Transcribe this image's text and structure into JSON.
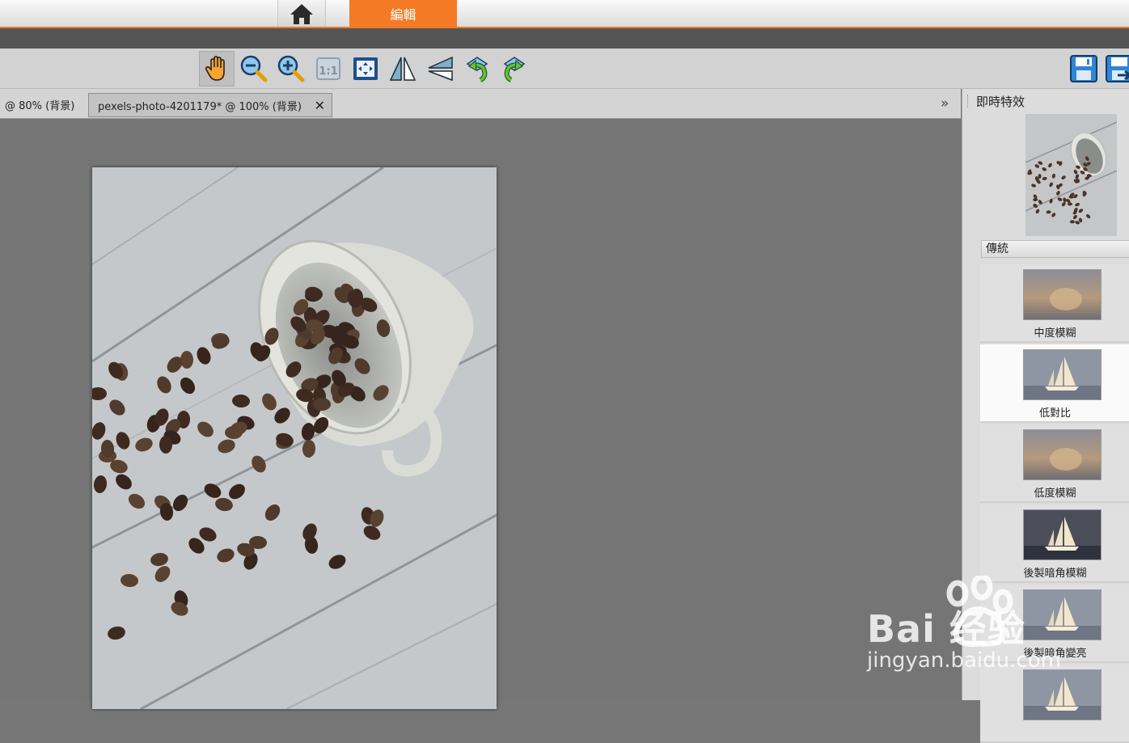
{
  "menu": {
    "edit_tab_label": "編輯"
  },
  "toolbar": {
    "tools": [
      "hand-tool",
      "zoom-out",
      "zoom-in",
      "actual-size",
      "fit-to-window",
      "flip-horizontal",
      "flip-vertical",
      "rotate-left",
      "rotate-right",
      "save",
      "save-as"
    ]
  },
  "tabs": [
    {
      "label": "@  80% (背景)"
    },
    {
      "label": "pexels-photo-4201179* @ 100% (背景)",
      "close": "✕"
    }
  ],
  "tabs_chevron": "»",
  "panel": {
    "title": "即時特效",
    "category": "傳統",
    "effects": [
      {
        "label": "中度模糊",
        "selected": false
      },
      {
        "label": "低對比",
        "selected": true
      },
      {
        "label": "低度模糊",
        "selected": false
      },
      {
        "label": "後製暗角模糊",
        "selected": false
      },
      {
        "label": "後製暗角變亮",
        "selected": false
      },
      {
        "label": "",
        "selected": false
      }
    ]
  },
  "watermark": {
    "brand": "Bai  经验",
    "url": "jingyan.baidu.com"
  },
  "colors": {
    "accent": "#f47a26",
    "toolbar": "#d2d2d2",
    "canvas": "#757575",
    "panel": "#dcdcdc"
  }
}
